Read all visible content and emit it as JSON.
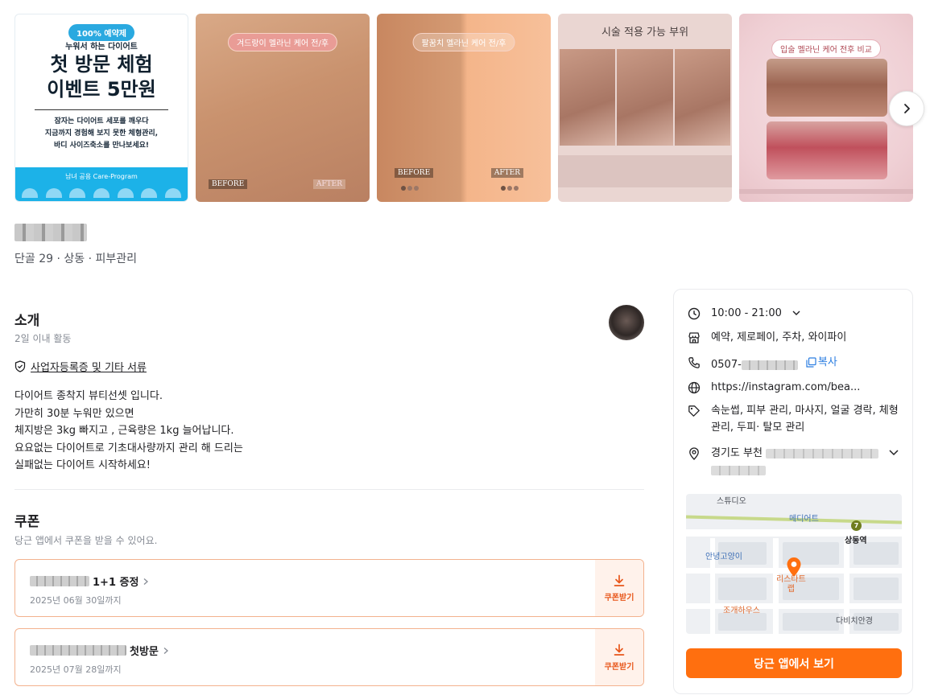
{
  "gallery": {
    "slide1": {
      "badge": "100% 예약제",
      "subtitle": "누워서 하는 다이어트",
      "headline_1": "첫 방문 체험",
      "headline_2": "이벤트 5만원",
      "desc_1": "잠자는 다이어트 세포를 깨우다",
      "desc_2": "지금까지 경험해 보지 못한 체형관리,",
      "desc_3": "바디 사이즈축소를          만나보세요!",
      "bar_label": "남녀 공용 Care-Program"
    },
    "slide2": {
      "pill": "겨드랑이 멜라닌 케어 전/후",
      "before": "BEFORE",
      "after": "AFTER"
    },
    "slide3": {
      "pill": "팔꿈치 멜라닌 케어 전/후",
      "before": "BEFORE",
      "after": "AFTER"
    },
    "slide4": {
      "heading": "시술 적용 가능 부위"
    },
    "slide5": {
      "pill": "입술 멜라닌 케어 전후 비교"
    },
    "next_icon": "chevron-right-icon"
  },
  "business": {
    "meta": "단골 29 · 상동 · 피부관리"
  },
  "intro": {
    "title": "소개",
    "activity": "2일 이내 활동",
    "docs_link": "사업자등록증 및 기타 서류",
    "body_lines": [
      "다이어트 종착지                  뷰티선셋 입니다.",
      "가만히 30분 누워만 있으면",
      "체지방은 3kg 빠지고 , 근육량은 1kg 늘어납니다.",
      "요요없는 다이어트로 기초대사량까지 관리 해 드리는",
      "실패없는 다이어트 시작하세요!"
    ]
  },
  "coupons": {
    "title": "쿠폰",
    "desc": "당근 앱에서 쿠폰을 받을 수 있어요.",
    "items": [
      {
        "name": "1+1 증정",
        "date": "2025년 06월 30일까지",
        "button": "쿠폰받기"
      },
      {
        "name": "첫방문",
        "date": "2025년 07월 28일까지",
        "button": "쿠폰받기"
      }
    ]
  },
  "info": {
    "hours": "10:00 - 21:00",
    "facilities": "예약, 제로페이, 주차, 와이파이",
    "phone": "0507-",
    "copy_label": "복사",
    "website": "https://instagram.com/bea...",
    "tags": "속눈썹, 피부 관리, 마사지, 얼굴 경락, 체형관리, 두피·  탈모 관리",
    "address": "경기도 부천"
  },
  "map": {
    "labels": {
      "studio": "스튜디오",
      "mediate": "메디어트",
      "station": "상동역",
      "line_no": "7",
      "pet": "안녕고양이",
      "pin_label": "리스타트\n랩",
      "restaurant": "조개하우스",
      "davinci": "다비치안경"
    }
  },
  "cta": {
    "label": "당근 앱에서 보기"
  },
  "colors": {
    "accent": "#ff6f0f",
    "coupon_border": "#f3b28e",
    "link": "#2a7de1"
  }
}
